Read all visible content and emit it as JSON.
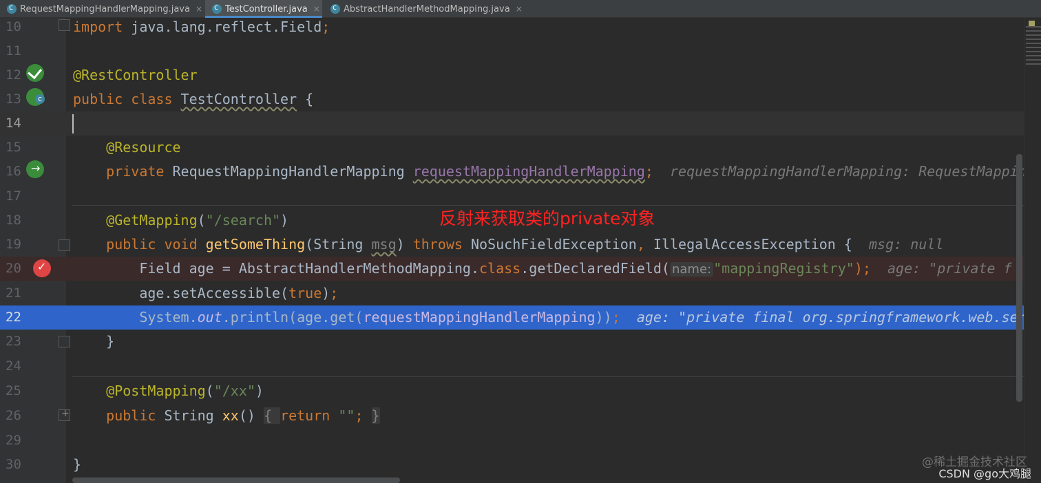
{
  "tabs": [
    {
      "label": "RequestMappingHandlerMapping.java",
      "close": "×"
    },
    {
      "label": "TestController.java",
      "close": "×"
    },
    {
      "label": "AbstractHandlerMethodMapping.java",
      "close": "×"
    }
  ],
  "lines": {
    "l10": {
      "num": "10",
      "t1": "import",
      "t2": " java.lang.reflect.Field",
      "t3": ";"
    },
    "l11": {
      "num": "11"
    },
    "l12": {
      "num": "12",
      "t1": "@RestController"
    },
    "l13": {
      "num": "13",
      "t1": "public class ",
      "t2": "TestController",
      "t3": " {"
    },
    "l14": {
      "num": "14"
    },
    "l15": {
      "num": "15",
      "t1": "    @Resource"
    },
    "l16": {
      "num": "16",
      "t1": "    private ",
      "t2": "RequestMappingHandlerMapping ",
      "t3": "requestMappingHandlerMapping",
      "t4": ";",
      "hint": "  requestMappingHandlerMapping: RequestMappin"
    },
    "l17": {
      "num": "17"
    },
    "l18": {
      "num": "18",
      "t1": "    @GetMapping",
      "t2": "(",
      "t3": "\"/search\"",
      "t4": ")"
    },
    "l19": {
      "num": "19",
      "t1": "    public void ",
      "t2": "getSomeThing",
      "t3": "(String ",
      "t4": "msg",
      "t5": ") ",
      "t6": "throws ",
      "t7": "NoSuchFieldException",
      "t8": ", ",
      "t9": "IllegalAccessException {",
      "hint": "  msg: null"
    },
    "l20": {
      "num": "20",
      "t1": "        Field age = AbstractHandlerMethodMapping.",
      "t2": "class",
      "t3": ".getDeclaredField(",
      "param": "name:",
      "t4": "\"mappingRegistry\"",
      "t5": ");",
      "hint": "  age: \"private f"
    },
    "l21": {
      "num": "21",
      "t1": "        age.setAccessible(",
      "t2": "true",
      "t3": ")",
      "t4": ";"
    },
    "l22": {
      "num": "22",
      "t1": "        System.",
      "t2": "out",
      "t3": ".println(age.get(",
      "t4": "requestMappingHandlerMapping",
      "t5": "))",
      "t6": ";",
      "hint": "  age: \"private final org.springframework.web.ser"
    },
    "l23": {
      "num": "23",
      "t1": "    }"
    },
    "l24": {
      "num": "24"
    },
    "l25": {
      "num": "25",
      "t1": "    @PostMapping",
      "t2": "(",
      "t3": "\"/xx\"",
      "t4": ")"
    },
    "l26": {
      "num": "26",
      "t1": "    public ",
      "t2": "String ",
      "t3": "xx",
      "t4": "() ",
      "t5": "{ ",
      "t6": "return ",
      "t7": "\"\"",
      "t8": "; ",
      "t9": "}"
    },
    "l29": {
      "num": "29"
    },
    "l30": {
      "num": "30",
      "t1": "}"
    }
  },
  "annotation": "反射来获取类的private对象",
  "watermark": {
    "line1": "@稀土掘金技术社区",
    "line2": "CSDN @go大鸡腿"
  },
  "gutter_icons": [
    "bean-icon",
    "class-icon",
    "navigate-icon",
    "breakpoint-icon"
  ],
  "colors": {
    "keyword": "#cc7832",
    "annotation": "#bbb529",
    "string": "#6a8759",
    "field": "#9876aa",
    "selection": "#2f65ca",
    "annotation_text": "#ff2222"
  }
}
